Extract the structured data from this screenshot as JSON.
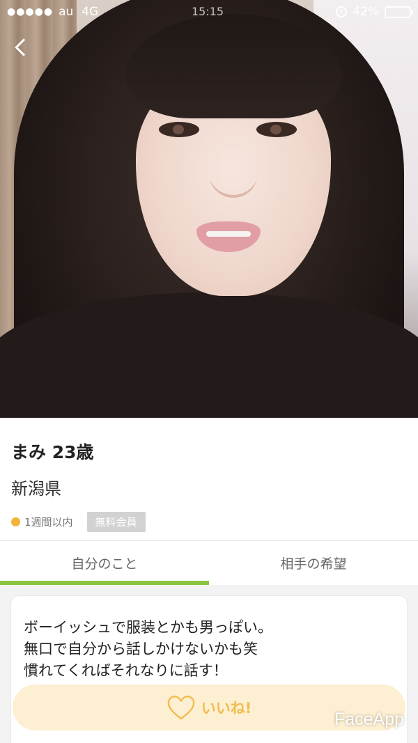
{
  "status_bar": {
    "signal": "●●●●●",
    "carrier": "au",
    "network": "4G",
    "time": "15:15",
    "battery_percent": "42%",
    "battery_level": 0.42
  },
  "profile": {
    "name_age": "まみ 23歳",
    "prefecture": "新潟県",
    "last_login": "1週間以内",
    "membership": "無料会員",
    "online_dot_color": "#f2b33b"
  },
  "tabs": [
    {
      "label": "自分のこと",
      "active": true
    },
    {
      "label": "相手の希望",
      "active": false
    }
  ],
  "intro": {
    "lines": [
      "ボーイッシュで服装とかも男っぽい。",
      "無口で自分から話しかけないかも笑",
      "慣れてくればそれなりに話す！"
    ]
  },
  "like_button": {
    "label": "いいね!",
    "icon": "heart-icon"
  },
  "watermark": "FaceApp",
  "colors": {
    "accent_green": "#8bc43f",
    "like_bg": "#fdeecf",
    "like_text": "#f1bd50"
  }
}
